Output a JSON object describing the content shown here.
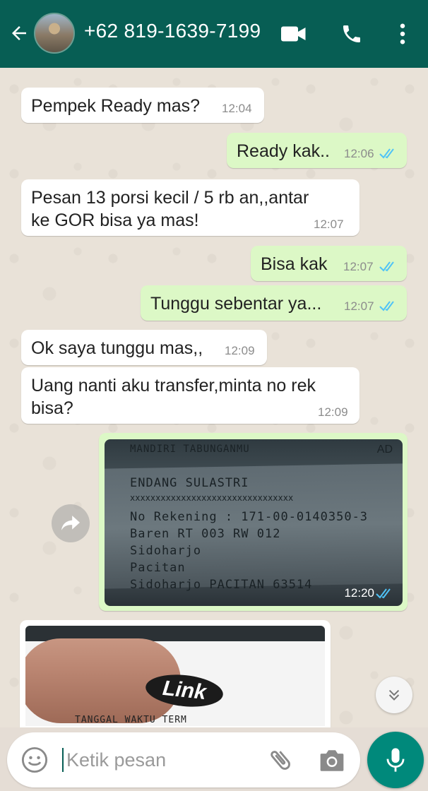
{
  "header": {
    "contact": "+62 819-1639-7199",
    "icons": [
      "back-arrow-icon",
      "avatar",
      "video-call-icon",
      "phone-icon",
      "more-vert-icon"
    ],
    "bg_color": "#075e54"
  },
  "messages": [
    {
      "dir": "in",
      "text": "Pempek Ready mas?",
      "time": "12:04"
    },
    {
      "dir": "out",
      "text": "Ready kak..",
      "time": "12:06",
      "status": "read"
    },
    {
      "dir": "in",
      "text": "Pesan 13 porsi kecil / 5 rb an,,antar\nke GOR bisa ya mas!",
      "time": "12:07"
    },
    {
      "dir": "out",
      "text": "Bisa kak",
      "time": "12:07",
      "status": "read"
    },
    {
      "dir": "out",
      "text": "Tunggu sebentar ya...",
      "time": "12:07",
      "status": "read"
    },
    {
      "dir": "in",
      "text": "Ok saya tunggu mas,,",
      "time": "12:09"
    },
    {
      "dir": "in",
      "text": "Uang nanti aku transfer,minta no rek\nbisa?",
      "time": "12:09"
    }
  ],
  "image_message": {
    "time": "12:20",
    "status": "read",
    "receipt_lines": [
      "MANDIRI TABUNGANMU",
      "ENDANG SULASTRI",
      "xxxxxxxxxxxxxxxxxxxxxxxxxxxxxxxx",
      "No Rekening : 171-00-0140350-3",
      "Baren RT 003 RW 012",
      "Sidoharjo",
      "Pacitan",
      "Sidoharjo PACITAN 63514"
    ],
    "corner_text": "AD"
  },
  "card_image": {
    "logo_text": "Link",
    "footer_text": "TANGGAL     WAKTU      TERM"
  },
  "composer": {
    "placeholder": "Ketik pesan"
  },
  "colors": {
    "outgoing": "#dcf8c6",
    "incoming": "#ffffff",
    "tick_read": "#4fc3f7",
    "accent": "#00897b"
  }
}
